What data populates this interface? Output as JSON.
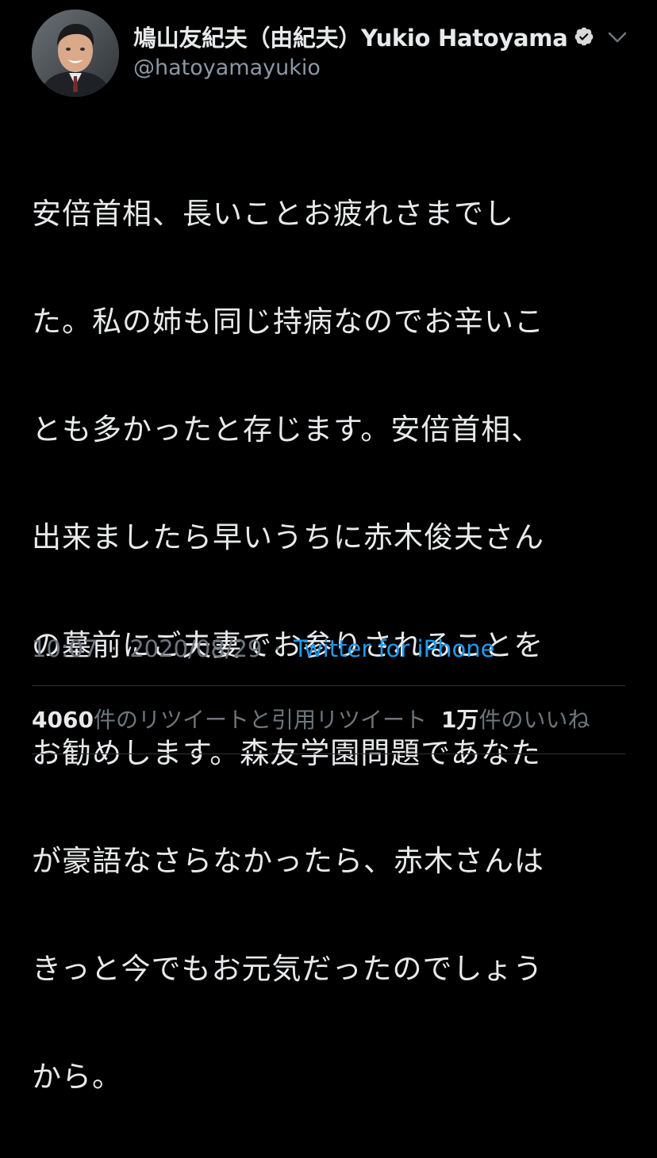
{
  "tweet": {
    "author": {
      "display_name": "鳩山友紀夫（由紀夫）Yukio Hatoyama",
      "handle": "@hatoyamayukio",
      "verified": true
    },
    "text": "安倍首相、長いことお疲れさまでした。私の姉も同じ持病なのでお辛いことも多かったと存じます。安倍首相、出来ましたら早いうちに赤木俊夫さんの墓前にご夫妻でお参りされることをお勧めします。森友学園問題であなたが豪語なさらなかったら、赤木さんはきっと今でもお元気だったのでしょうから。",
    "lines": [
      "安倍首相、長いことお疲れさまでし",
      "た。私の姉も同じ持病なのでお辛いこ",
      "とも多かったと存じます。安倍首相、",
      "出来ましたら早いうちに赤木俊夫さん",
      "の墓前にご夫妻でお参りされることを",
      "お勧めします。森友学園問題であなた",
      "が豪語なさらなかったら、赤木さんは",
      "きっと今でもお元気だったのでしょう",
      "から。"
    ],
    "time": "10:07",
    "separator": "·",
    "date": "2020/08/29",
    "source": "Twitter for iPhone",
    "stats": {
      "retweets_count": "4060",
      "retweets_label": "件のリツイートと引用リツイート",
      "likes_count": "1万",
      "likes_label": "件のいいね"
    }
  },
  "icons": {
    "verified": "verified-badge-icon",
    "caret": "chevron-down-icon"
  },
  "colors": {
    "background": "#000000",
    "text_primary": "#e7e9ea",
    "text_secondary": "#6e767d",
    "link": "#1d9bf0",
    "divider": "#2f3336"
  }
}
